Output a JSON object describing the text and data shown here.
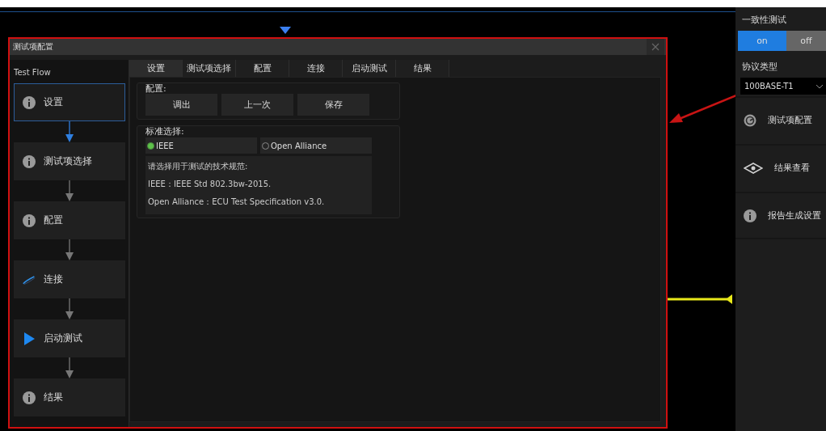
{
  "dialog": {
    "title": "测试项配置",
    "flow_title": "Test Flow",
    "flow_steps": [
      {
        "label": "设置",
        "kind": "info",
        "selected": true
      },
      {
        "label": "测试项选择",
        "kind": "info",
        "selected": false
      },
      {
        "label": "配置",
        "kind": "info",
        "selected": false
      },
      {
        "label": "连接",
        "kind": "cable",
        "selected": false
      },
      {
        "label": "启动测试",
        "kind": "play",
        "selected": false
      },
      {
        "label": "结果",
        "kind": "info",
        "selected": false
      }
    ],
    "tabs": [
      {
        "label": "设置",
        "selected": true
      },
      {
        "label": "测试项选择",
        "selected": false
      },
      {
        "label": "配置",
        "selected": false
      },
      {
        "label": "连接",
        "selected": false
      },
      {
        "label": "启动测试",
        "selected": false
      },
      {
        "label": "结果",
        "selected": false
      }
    ],
    "config": {
      "label": "配置:",
      "buttons": [
        "调出",
        "上一次",
        "保存"
      ]
    },
    "standard": {
      "label": "标准选择:",
      "options": [
        {
          "label": "IEEE",
          "selected": true
        },
        {
          "label": "Open Alliance",
          "selected": false
        }
      ],
      "description": [
        "请选择用于测试的技术规范:",
        "IEEE：IEEE Std 802.3bw-2015.",
        "Open Alliance：ECU Test Specification v3.0."
      ]
    }
  },
  "side_panel": {
    "title": "一致性测试",
    "toggle": [
      {
        "label": "on",
        "selected": true
      },
      {
        "label": "off",
        "selected": false
      }
    ],
    "protocol_label": "协议类型",
    "protocol": "100BASE-T1",
    "items": [
      {
        "label": "测试项配置",
        "kind": "dial"
      },
      {
        "label": "结果查看",
        "kind": "eye"
      },
      {
        "label": "报告生成设置",
        "kind": "info"
      }
    ]
  }
}
